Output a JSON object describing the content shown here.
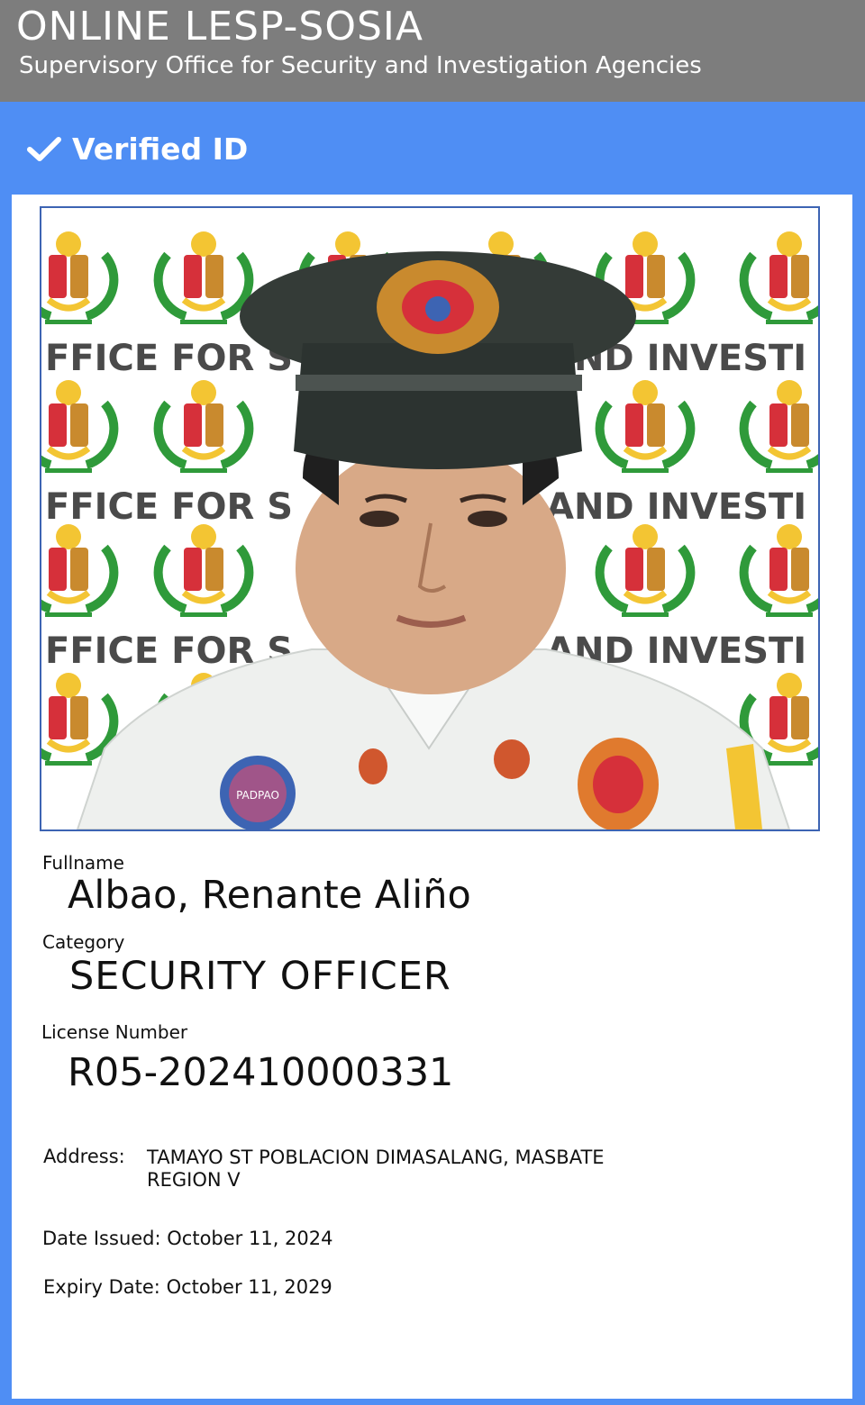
{
  "header": {
    "title": "ONLINE LESP-SOSIA",
    "subtitle": "Supervisory Office for Security and Investigation Agencies"
  },
  "status": {
    "verified_label": "Verified ID",
    "verified_icon": "checkmark-icon"
  },
  "photo": {
    "backdrop_text_left": "FFICE FOR S",
    "backdrop_text_right": "AND INVESTI",
    "badge_text": "PADPAO"
  },
  "fields": {
    "fullname_label": "Fullname",
    "fullname_value": "Albao, Renante Aliño",
    "category_label": "Category",
    "category_value": "SECURITY OFFICER",
    "license_label": "License Number",
    "license_value": "R05-202410000331",
    "address_label": "Address:",
    "address_line1": "TAMAYO ST POBLACION DIMASALANG, MASBATE",
    "address_line2": "REGION V",
    "date_issued_label": "Date Issued:",
    "date_issued_value": "October 11, 2024",
    "expiry_label": "Expiry Date:",
    "expiry_value": "October 11, 2029"
  },
  "colors": {
    "header_bg": "#7d7d7d",
    "frame_blue": "#4f8ef4",
    "photo_border": "#3d64b3"
  }
}
